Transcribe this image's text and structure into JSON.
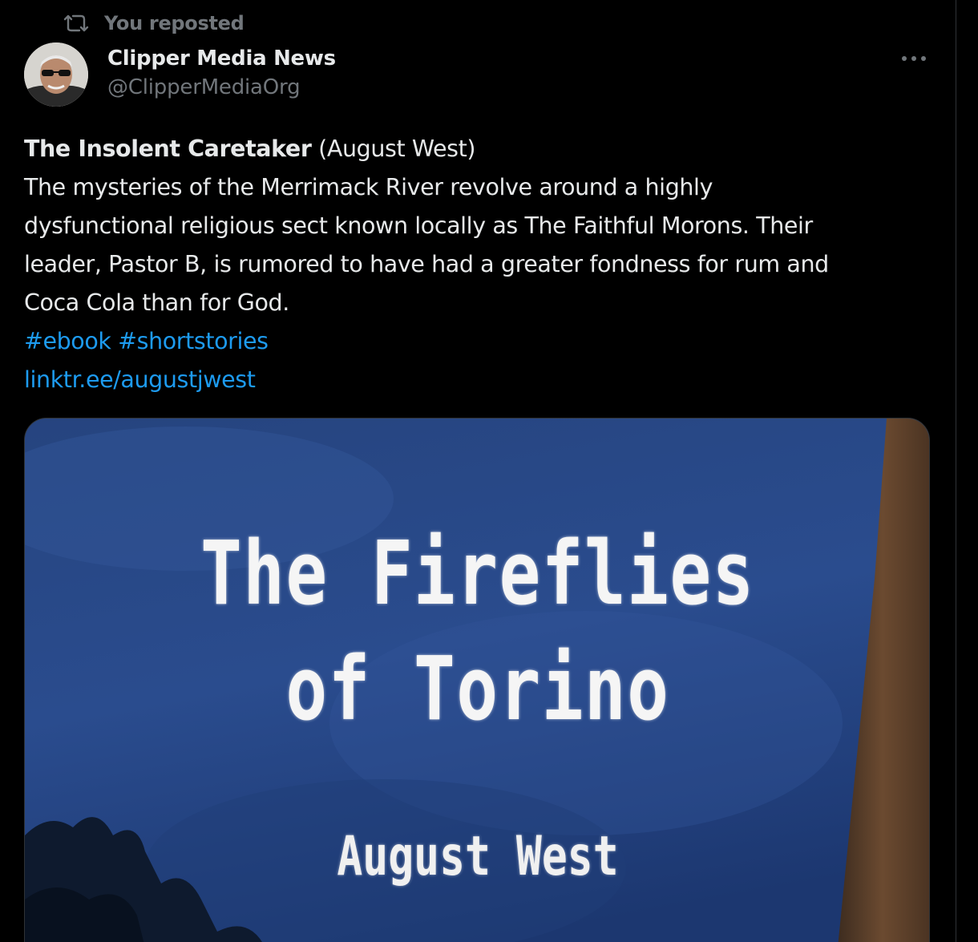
{
  "repost": {
    "icon": "repost-icon",
    "label": "You reposted"
  },
  "author": {
    "name": "Clipper Media News",
    "handle": "@ClipperMediaOrg"
  },
  "more": {
    "icon": "more-horizontal-icon"
  },
  "tweet": {
    "title": "The Insolent Caretaker",
    "title_suffix": " (August West)",
    "body_lines": [
      "The mysteries of the Merrimack River revolve around a highly",
      "dysfunctional religious sect known locally as The Faithful Morons. Their",
      "leader, Pastor B, is rumored to have had a greater fondness for rum and",
      "Coca Cola than for God."
    ],
    "hashtags": [
      "#ebook",
      "#shortstories"
    ],
    "link": "linktr.ee/augustjwest"
  },
  "media": {
    "cover_title_line1": "The Fireflies",
    "cover_title_line2": "of Torino",
    "cover_author": "August West"
  },
  "colors": {
    "background": "#000000",
    "text": "#e7e9ea",
    "secondary": "#71767b",
    "link": "#1d9bf0",
    "border": "#2f3336"
  }
}
